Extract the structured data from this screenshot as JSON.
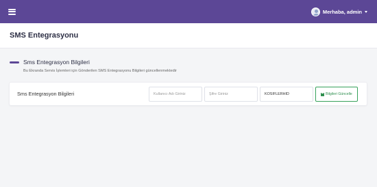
{
  "topbar": {
    "menu_icon": "hamburger-icon",
    "user_greeting": "Merhaba, admin",
    "avatar_icon": "user-avatar-icon",
    "caret_icon": "caret-down-icon"
  },
  "page": {
    "title": "SMS Entegrasyonu"
  },
  "section": {
    "title": "Sms Entegrasyon Bilgileri",
    "subtitle": "Bu Ekranda Servis İşlemleri için Gönderilen SMS Entegrasyonu Bilgileri güncellenmektedir"
  },
  "form": {
    "label": "Sms Entegrasyon Bilgileri",
    "username_placeholder": "Kullanıcı Adı Giriniz",
    "username_value": "",
    "password_placeholder": "Şifre Giriniz",
    "password_value": "",
    "sender_value": "KOSIFLERHID",
    "update_button": "Bilgileri Güncelle",
    "update_icon": "save-icon"
  },
  "colors": {
    "brand": "#5c4796",
    "success": "#35a15a",
    "background": "#f4f5f7"
  }
}
